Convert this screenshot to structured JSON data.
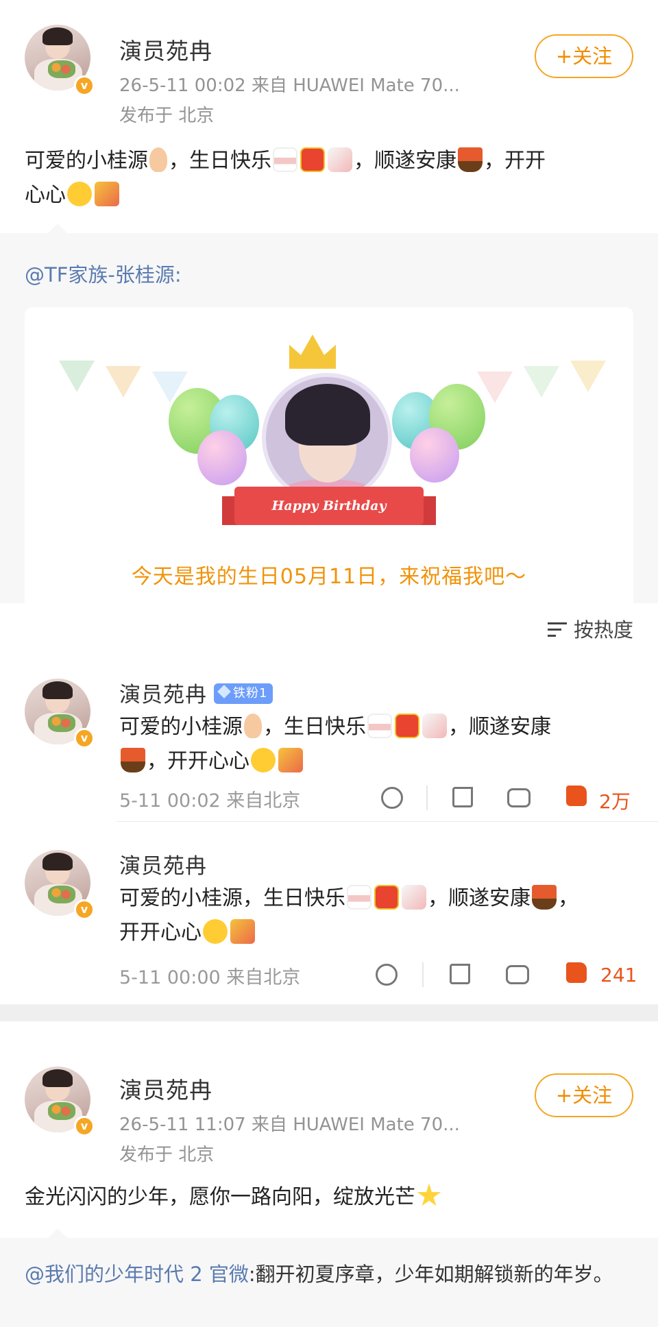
{
  "post1": {
    "author": "演员苑冉",
    "time_source": "26-5-11 00:02  来自 HUAWEI Mate 70...",
    "location": "发布于 北京",
    "follow_label": "+关注",
    "text_parts": [
      "可爱的小桂源",
      "，生日快乐",
      "，顺遂安康",
      "，开开",
      "心心"
    ]
  },
  "repost1": {
    "mention": "@TF家族-张桂源:",
    "card": {
      "ribbon_text": "Happy Birthday",
      "caption": "今天是我的生日05月11日，来祝福我吧～"
    }
  },
  "sort": {
    "label": "按热度"
  },
  "comments": [
    {
      "author": "演员苑冉",
      "badge": "铁粉1",
      "text_line1": [
        "可爱的小桂源",
        "，生日快乐",
        "，顺遂安康"
      ],
      "text_line2": [
        "，开开心心"
      ],
      "time": "5-11 00:02  来自北京",
      "likes": "2万"
    },
    {
      "author": "演员苑冉",
      "text_line1": [
        "可爱的小桂源，生日快乐",
        "，顺遂安康",
        "，"
      ],
      "text_line2": [
        "开开心心"
      ],
      "time": "5-11 00:00  来自北京",
      "likes": "241"
    }
  ],
  "post2": {
    "author": "演员苑冉",
    "time_source": "26-5-11 11:07  来自 HUAWEI Mate 70...",
    "location": "发布于 北京",
    "follow_label": "+关注",
    "text": "金光闪闪的少年，愿你一路向阳，绽放光芒",
    "repost_mention": "@我们的少年时代 2 官微",
    "repost_text": ":翻开初夏序章，少年如期解锁新的年岁。"
  },
  "icons": [
    "hand-heart-icon",
    "cake-icon",
    "gift-icon",
    "ribbon-icon",
    "sailboat-icon",
    "smile-icon",
    "party-popper-icon",
    "star-icon",
    "sad-face-icon",
    "share-icon",
    "comment-icon",
    "like-icon",
    "sort-icon",
    "diamond-icon",
    "verified-badge-icon"
  ],
  "colors": {
    "accent_orange": "#f08c00",
    "link_blue": "#5a7bb0",
    "like_red": "#e8541c",
    "badge_blue": "#6c9dfa"
  }
}
